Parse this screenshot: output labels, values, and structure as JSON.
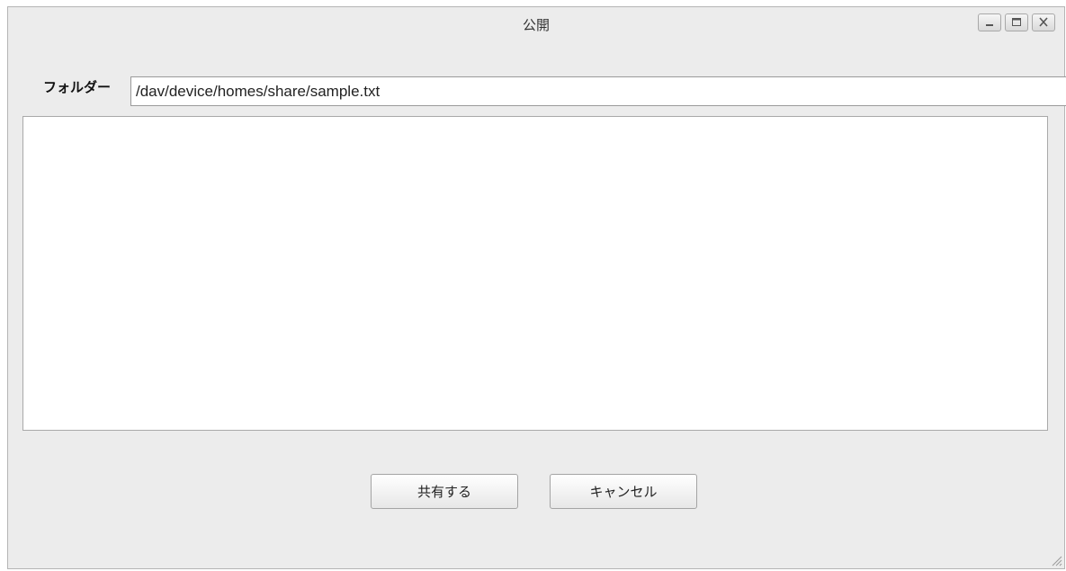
{
  "window": {
    "title": "公開"
  },
  "form": {
    "folder_label": "フォルダー",
    "folder_path": "/dav/device/homes/share/sample.txt",
    "message": ""
  },
  "buttons": {
    "share_label": "共有する",
    "cancel_label": "キャンセル"
  }
}
